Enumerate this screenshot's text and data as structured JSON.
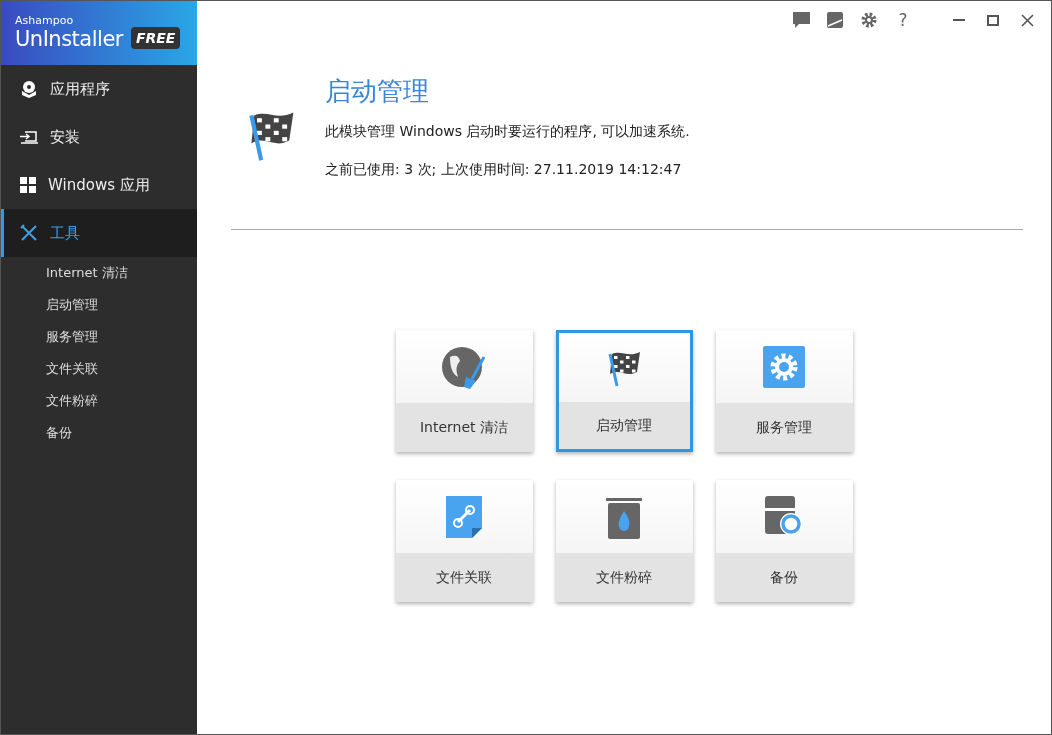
{
  "logo": {
    "brand": "Ashampoo",
    "product": "UnInstaller",
    "badge": "FREE"
  },
  "sidebar": {
    "items": [
      {
        "label": "应用程序",
        "selected": false
      },
      {
        "label": "安装",
        "selected": false
      },
      {
        "label": "Windows 应用",
        "selected": false
      },
      {
        "label": "工具",
        "selected": true,
        "children": [
          {
            "label": "Internet 清洁"
          },
          {
            "label": "启动管理"
          },
          {
            "label": "服务管理"
          },
          {
            "label": "文件关联"
          },
          {
            "label": "文件粉碎"
          },
          {
            "label": "备份"
          }
        ]
      }
    ]
  },
  "title_bar": {
    "help": "?"
  },
  "header": {
    "title": "启动管理",
    "description": "此模块管理 Windows 启动时要运行的程序, 可以加速系统.",
    "usage": "之前已使用: 3 次; 上次使用时间: 27.11.2019 14:12:47"
  },
  "tiles": [
    {
      "label": "Internet 清洁",
      "selected": false
    },
    {
      "label": "启动管理",
      "selected": true
    },
    {
      "label": "服务管理",
      "selected": false
    },
    {
      "label": "文件关联",
      "selected": false
    },
    {
      "label": "文件粉碎",
      "selected": false
    },
    {
      "label": "备份",
      "selected": false
    }
  ]
}
